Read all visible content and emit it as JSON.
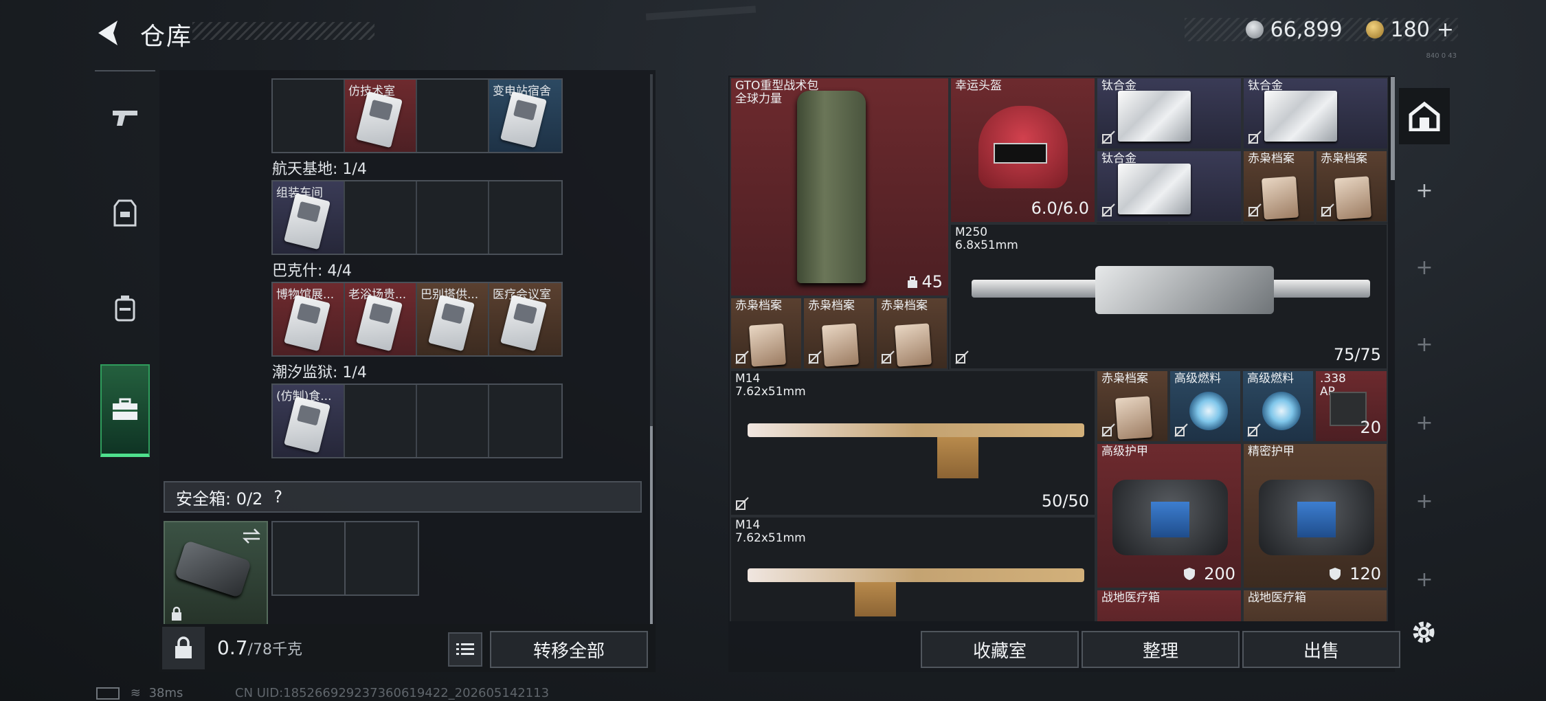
{
  "header": {
    "title": "仓库",
    "currency_silver": "66,899",
    "currency_gold": "180",
    "gold_add": "+",
    "version_tiny": "840 0 43"
  },
  "left_tabs": [
    "pistol-icon",
    "armor-vest-icon",
    "backpack-icon",
    "briefcase-icon"
  ],
  "left_panel": {
    "top_row": [
      {
        "label": ""
      },
      {
        "label": "仿技术室"
      },
      {
        "label": ""
      },
      {
        "label": "变电站宿舍"
      }
    ],
    "sections": [
      {
        "title": "航天基地: 1/4",
        "cells": [
          {
            "label": "组装车间"
          },
          {
            "label": ""
          },
          {
            "label": ""
          },
          {
            "label": ""
          }
        ]
      },
      {
        "title": "巴克什: 4/4",
        "cells": [
          {
            "label": "博物馆展..."
          },
          {
            "label": "老浴场贵..."
          },
          {
            "label": "巴别塔供..."
          },
          {
            "label": "医疗会议室"
          }
        ]
      },
      {
        "title": "潮汐监狱: 1/4",
        "cells": [
          {
            "label": "(仿制)食..."
          },
          {
            "label": ""
          },
          {
            "label": ""
          },
          {
            "label": ""
          }
        ]
      }
    ],
    "safe_box_label": "安全箱: 0/2",
    "safe_help": "?",
    "weight_current": "0.7",
    "weight_max": "/78千克",
    "transfer_all": "转移全部"
  },
  "right_panel": {
    "items": [
      {
        "name": "GTO重型战术包\n全球力量",
        "value": "45"
      },
      {
        "name": "幸运头盔",
        "value": "6.0/6.0"
      },
      {
        "name": "钛合金"
      },
      {
        "name": "钛合金"
      },
      {
        "name": "钛合金"
      },
      {
        "name": "赤枭档案"
      },
      {
        "name": "赤枭档案"
      },
      {
        "name": "M250\n6.8x51mm",
        "value": "75/75"
      },
      {
        "name": "赤枭档案"
      },
      {
        "name": "赤枭档案"
      },
      {
        "name": "赤枭档案"
      },
      {
        "name": "M14\n7.62x51mm",
        "value": "50/50"
      },
      {
        "name": "赤枭档案"
      },
      {
        "name": "高级燃料"
      },
      {
        "name": "高级燃料"
      },
      {
        "name": ".338\nAP",
        "value": "20"
      },
      {
        "name": "高级护甲",
        "value": "200"
      },
      {
        "name": "精密护甲",
        "value": "120"
      },
      {
        "name": "M14\n7.62x51mm"
      },
      {
        "name": "战地医疗箱"
      },
      {
        "name": "战地医疗箱"
      }
    ],
    "buttons": {
      "collection": "收藏室",
      "sort": "整理",
      "sell": "出售"
    }
  },
  "status": {
    "ping": "38ms",
    "uid": "CN UID:185266929237360619422_202605142113"
  },
  "colors": {
    "accent_green": "#4fe08d",
    "rare_red": "#6e2a2e",
    "rare_purple": "#3a3b56",
    "rare_brown": "#5a4030",
    "rare_blue": "#2c4962"
  }
}
